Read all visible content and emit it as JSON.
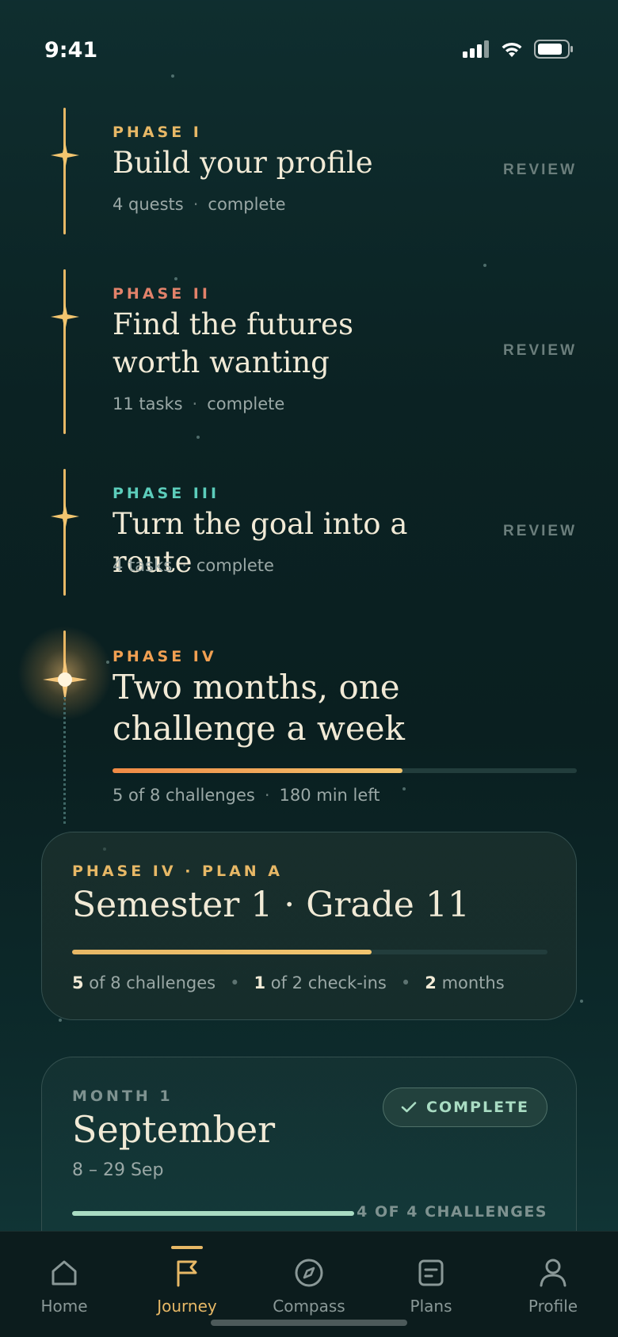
{
  "status_bar": {
    "time": "9:41"
  },
  "phases": [
    {
      "eyebrow": "PHASE I",
      "eyebrow_color": "#e7b866",
      "title": "Build your profile",
      "count": "4 quests",
      "state": "complete",
      "action": "REVIEW"
    },
    {
      "eyebrow": "PHASE II",
      "eyebrow_color": "#e2826a",
      "title": "Find the futures worth wanting",
      "count": "11 tasks",
      "state": "complete",
      "action": "REVIEW"
    },
    {
      "eyebrow": "PHASE III",
      "eyebrow_color": "#5ccdbb",
      "title": "Turn the goal into a route",
      "count": "4 tasks",
      "state": "complete",
      "action": "REVIEW"
    }
  ],
  "current_phase": {
    "eyebrow": "PHASE IV",
    "eyebrow_color": "#f1a052",
    "title": "Two months, one challenge a week",
    "progress": 0.625,
    "count": "5 of 8 challenges",
    "time_left": "180 min left"
  },
  "plan_card": {
    "eyebrow": "PHASE IV · PLAN A",
    "title": "Semester 1 · Grade 11",
    "progress": 0.63,
    "challenges_done": "5",
    "challenges_rest": " of 8 challenges",
    "checkins_done": "1",
    "checkins_rest": " of 2 check-ins",
    "months_num": "2",
    "months_rest": " months"
  },
  "month_card": {
    "eyebrow": "MONTH 1",
    "title": "September",
    "dates": "8 – 29 Sep",
    "badge": "COMPLETE",
    "count": "4 OF 4 CHALLENGES"
  },
  "tabs": [
    {
      "label": "Home",
      "icon": "home-icon"
    },
    {
      "label": "Journey",
      "icon": "flag-icon",
      "active": true
    },
    {
      "label": "Compass",
      "icon": "compass-icon"
    },
    {
      "label": "Plans",
      "icon": "plans-icon"
    },
    {
      "label": "Profile",
      "icon": "profile-icon"
    }
  ],
  "colors": {
    "accent": "#e7b866",
    "background": "#0b2223",
    "complete": "#a9dcc3"
  }
}
